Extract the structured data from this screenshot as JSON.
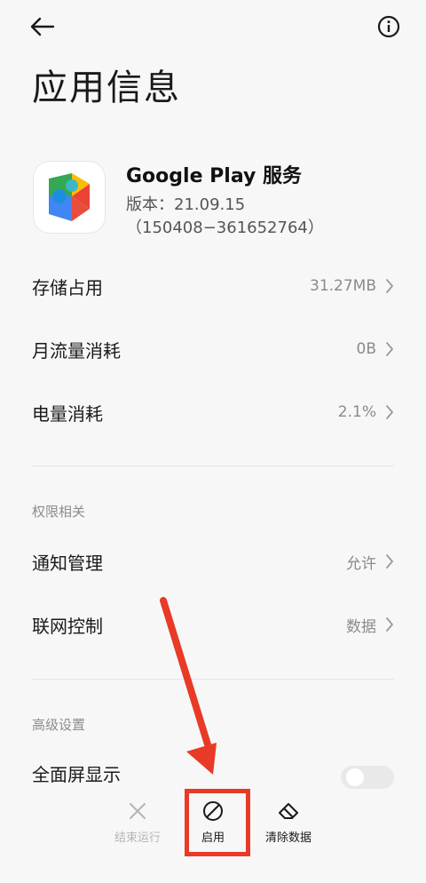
{
  "header": {
    "title": "应用信息",
    "back_icon": "back-arrow-icon",
    "info_icon": "info-icon"
  },
  "app": {
    "name": "Google Play 服务",
    "version": "版本：21.09.15",
    "build": "（150408−361652764）",
    "icon": "google-play-services-icon"
  },
  "rows": [
    {
      "label": "存储占用",
      "value": "31.27MB"
    },
    {
      "label": "月流量消耗",
      "value": "0B"
    },
    {
      "label": "电量消耗",
      "value": "2.1%"
    }
  ],
  "permissions_section": {
    "title": "权限相关",
    "rows": [
      {
        "label": "通知管理",
        "value": "允许"
      },
      {
        "label": "联网控制",
        "value": "数据"
      }
    ]
  },
  "advanced_section": {
    "title": "高级设置",
    "rows": [
      {
        "label": "全面屏显示"
      }
    ]
  },
  "bottom_actions": {
    "stop": {
      "label": "结束运行",
      "icon": "close-icon"
    },
    "enable": {
      "label": "启用",
      "icon": "disabled-circle-icon"
    },
    "clear": {
      "label": "清除数据",
      "icon": "eraser-icon"
    }
  },
  "colors": {
    "background": "#f7f7f7",
    "annotation_red": "#e83a26",
    "secondary_text": "#8a8a8a"
  }
}
